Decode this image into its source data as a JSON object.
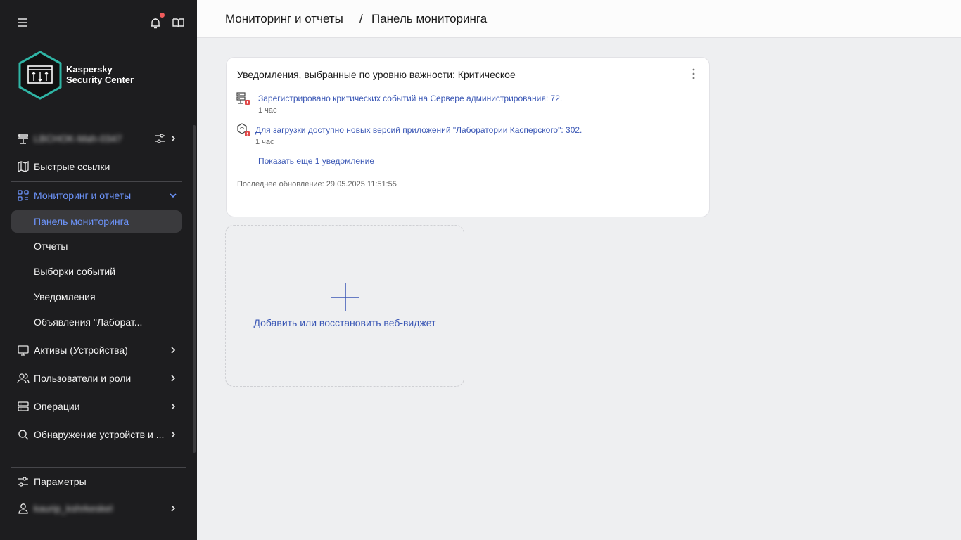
{
  "sidebar": {
    "icons": {
      "menu": "hamburger-icon",
      "notifications": "bell-icon",
      "help": "book-icon"
    },
    "logo": {
      "line1": "Kaspersky",
      "line2": "Security Center"
    },
    "server_name": "LBCHOK-Mah-0347",
    "quick_links": "Быстрые ссылки",
    "monitoring": "Мониторинг и отчеты",
    "sub_items": [
      "Панель мониторинга",
      "Отчеты",
      "Выборки событий",
      "Уведомления",
      "Объявления \"Лаборат..."
    ],
    "assets": "Активы (Устройства)",
    "users": "Пользователи и роли",
    "operations": "Операции",
    "discovery": "Обнаружение устройств и ...",
    "settings": "Параметры",
    "user_name": "kaurip_kshrkeskel"
  },
  "header": {
    "crumb1": "Мониторинг и отчеты",
    "sep": "/",
    "crumb2": "Панель мониторинга"
  },
  "widget": {
    "title": "Уведомления, выбранные по уровню важности: Критическое",
    "notifications": [
      {
        "text": "Зарегистрировано критических событий на Сервере администрирования: 72.",
        "time": "1 час"
      },
      {
        "text": "Для загрузки доступно новых версий приложений \"Лаборатории Касперского\": 302.",
        "time": "1 час"
      }
    ],
    "show_more": "Показать еще 1 уведомление",
    "last_update": "Последнее обновление: 29.05.2025 11:51:55"
  },
  "add_widget": {
    "label": "Добавить или восстановить веб-виджет"
  },
  "colors": {
    "sidebar_bg": "#1d1d1f",
    "accent": "#6e96ff",
    "link": "#3a57b5",
    "brand_teal": "#2fb5a5",
    "alert_red": "#e04848"
  }
}
